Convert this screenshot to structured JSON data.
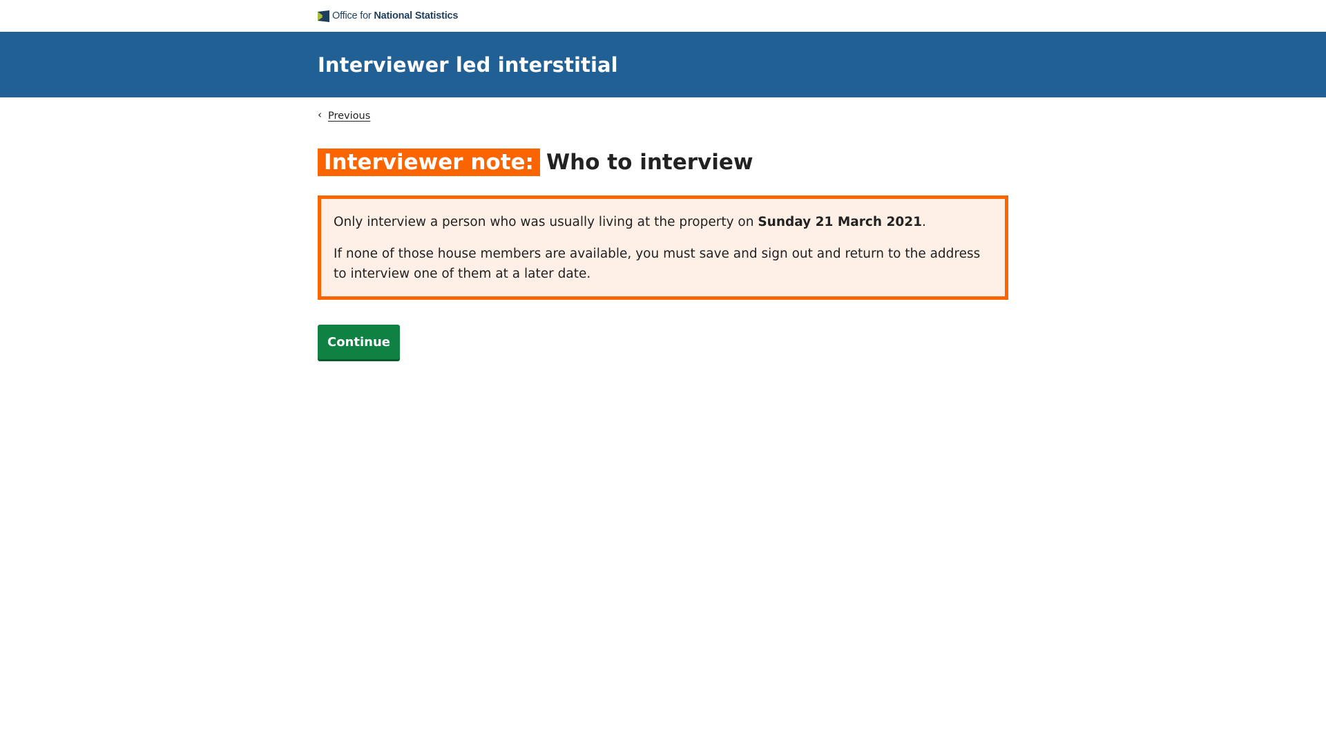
{
  "logo": {
    "prefix": "Office for ",
    "emphasis": "National Statistics",
    "icon": "ons-logo-icon",
    "colors": {
      "dark": "#1f3f5e",
      "green": "#a8bd3a"
    }
  },
  "header": {
    "title": "Interviewer led interstitial",
    "background": "#206095"
  },
  "nav": {
    "previous_label": "Previous",
    "previous_icon": "chevron-left-icon"
  },
  "page": {
    "badge": "Interviewer note:",
    "title": "Who to interview",
    "accent": "#fa6401"
  },
  "panel": {
    "line1_prefix": "Only interview a person who was usually living at the property on ",
    "line1_date": "Sunday 21 March 2021",
    "line1_suffix": ".",
    "line2": "If none of those house members are available, you must save and sign out and return to the address to interview one of them at a later date.",
    "background": "#fef0e6",
    "border": "#fa6401"
  },
  "actions": {
    "continue_label": "Continue",
    "continue_color": "#0f8243"
  }
}
